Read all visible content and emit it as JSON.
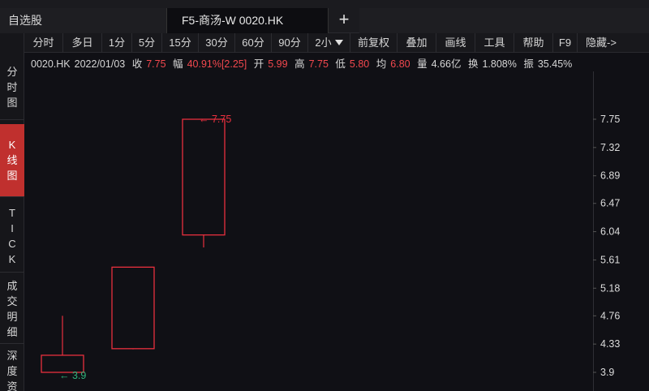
{
  "tabs": [
    {
      "label": "自选股"
    },
    {
      "label": "F5-商汤-W 0020.HK"
    }
  ],
  "add_tab_label": "+",
  "toolbar": {
    "items": [
      "分时",
      "多日",
      "1分",
      "5分",
      "15分",
      "30分",
      "60分",
      "90分",
      "2小",
      "前复权",
      "叠加",
      "画线",
      "工具",
      "帮助",
      "F9",
      "隐藏->"
    ]
  },
  "sidebar": {
    "items": [
      {
        "label": "分时图",
        "chars": [
          "分",
          "时",
          "图"
        ]
      },
      {
        "label": "K线图",
        "chars": [
          "K",
          "线",
          "图"
        ]
      },
      {
        "label": "TICK",
        "chars": [
          "T",
          "I",
          "C",
          "K"
        ]
      },
      {
        "label": "成交明细",
        "chars": [
          "成",
          "交",
          "明",
          "细"
        ]
      },
      {
        "label": "深度资",
        "chars": [
          "深",
          "度",
          "资"
        ]
      }
    ]
  },
  "quote": {
    "code": "0020.HK",
    "date": "2022/01/03",
    "close_label": "收",
    "close": "7.75",
    "change_label": "幅",
    "change": "40.91%[2.25]",
    "open_label": "开",
    "open": "5.99",
    "high_label": "高",
    "high": "7.75",
    "low_label": "低",
    "low": "5.80",
    "avg_label": "均",
    "avg": "6.80",
    "vol_label": "量",
    "vol": "4.66亿",
    "turnover_label": "换",
    "turnover": "1.808%",
    "amplitude_label": "振",
    "amplitude": "35.45%"
  },
  "chart_data": {
    "type": "candlestick",
    "candles": [
      {
        "open": 3.9,
        "close": 4.16,
        "high": 4.76,
        "low": 3.9
      },
      {
        "open": 4.26,
        "close": 5.5,
        "high": 5.5,
        "low": 4.25
      },
      {
        "open": 5.99,
        "close": 7.75,
        "high": 7.75,
        "low": 5.8
      }
    ],
    "y_ticks": [
      "7.75",
      "7.32",
      "6.89",
      "6.47",
      "6.04",
      "5.61",
      "5.18",
      "4.76",
      "4.33",
      "3.9"
    ],
    "ylim": [
      3.9,
      7.75
    ],
    "max_marker": "← 7.75",
    "min_marker": "← 3.9",
    "colors": {
      "up": "#e8303e",
      "grid": "#2f2f35",
      "axis_text": "#dcdcdc",
      "min_marker": "#2db37a",
      "max_marker": "#e8303e"
    }
  }
}
